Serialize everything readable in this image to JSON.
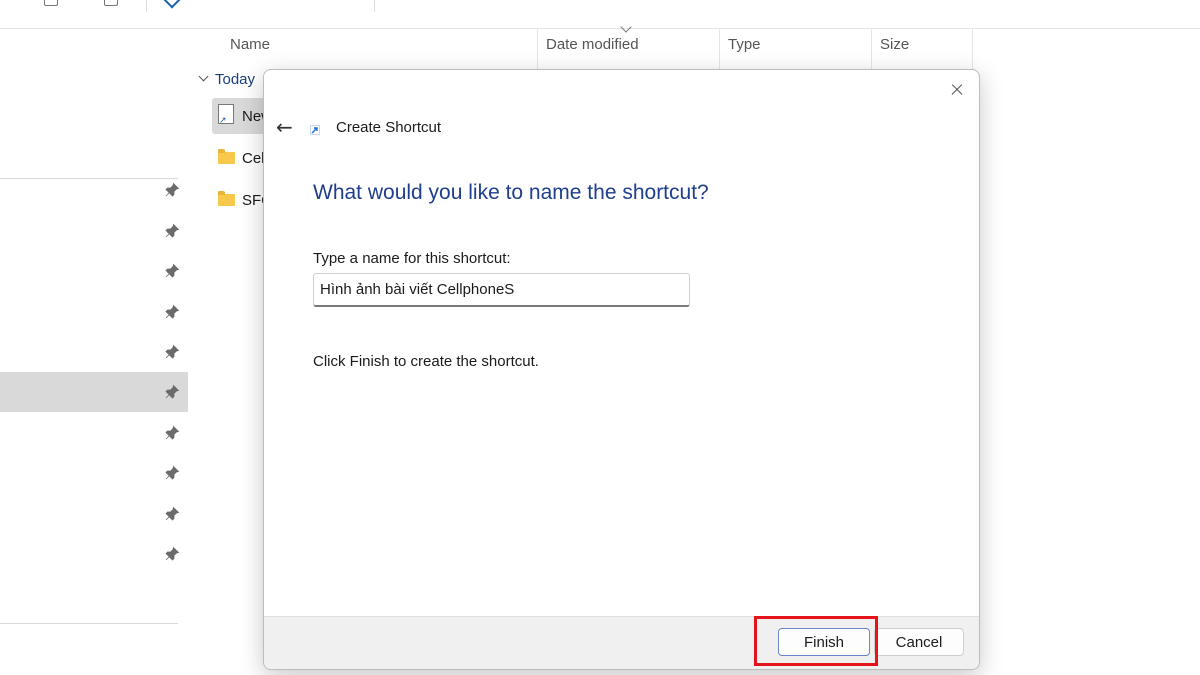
{
  "explorer": {
    "columns": [
      "Name",
      "Date modified",
      "Type",
      "Size"
    ],
    "group": "Today",
    "files": [
      {
        "name": "New",
        "kind": "shortcut",
        "selected": true
      },
      {
        "name": "CellphoneS",
        "kind": "folder",
        "selected": false
      },
      {
        "name": "SFC",
        "kind": "folder",
        "selected": false
      }
    ]
  },
  "dialog": {
    "window_title": "Create Shortcut",
    "heading": "What would you like to name the shortcut?",
    "field_label": "Type a name for this shortcut:",
    "name_value": "Hình ảnh bài viết CellphoneS",
    "hint": "Click Finish to create the shortcut.",
    "finish_label": "Finish",
    "cancel_label": "Cancel"
  },
  "colors": {
    "heading": "#1f3e8c",
    "highlight": "#e5141a",
    "folder": "#f8c84a"
  },
  "icons": [
    "back-arrow-icon",
    "shortcut-icon",
    "close-icon",
    "pin-icon",
    "folder-icon",
    "chevron-down-icon"
  ]
}
